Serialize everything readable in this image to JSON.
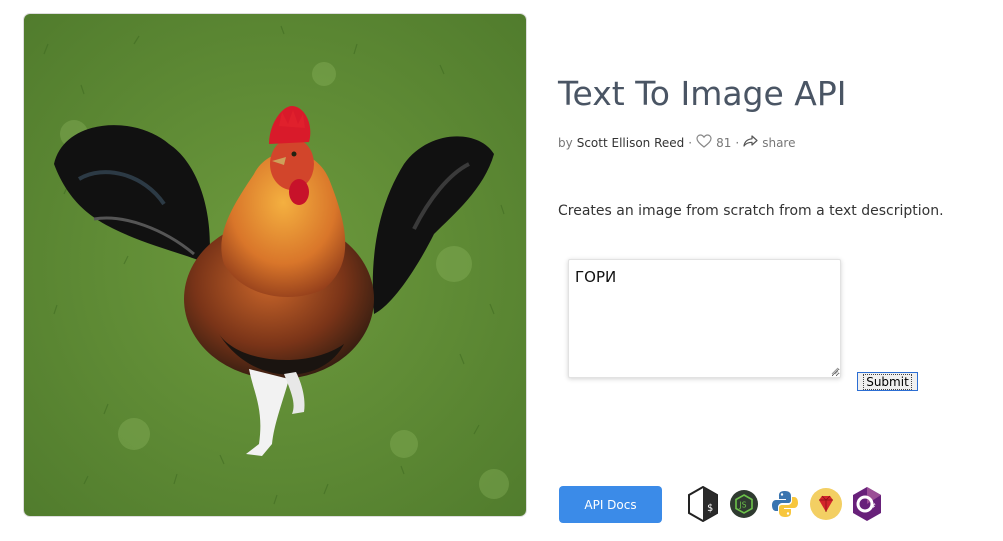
{
  "header": {
    "title": "Text To Image API",
    "by_prefix": "by",
    "author": "Scott Ellison Reed",
    "separator": "·",
    "likes": "81",
    "share_label": "share"
  },
  "description": "Creates an image from scratch from a text description.",
  "form": {
    "prompt_value": "ГОРИ",
    "submit_label": "Submit"
  },
  "footer": {
    "api_docs_label": "API Docs",
    "languages": [
      "bash-icon",
      "nodejs-icon",
      "python-icon",
      "ruby-icon",
      "csharp-icon"
    ]
  },
  "colors": {
    "title": "#4a5564",
    "api_docs_bg": "#3b8be8",
    "grass": "#5e8a36"
  },
  "image": {
    "subject": "rooster-image"
  }
}
